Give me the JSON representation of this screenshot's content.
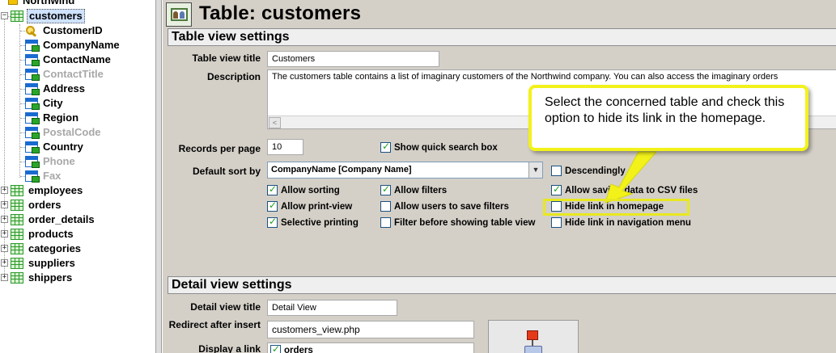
{
  "tree": {
    "root": "Northwind",
    "selected_table": "customers",
    "fields": [
      {
        "label": "CustomerID",
        "icon": "key-icon",
        "dim": false
      },
      {
        "label": "CompanyName",
        "icon": "field-icon",
        "dim": false
      },
      {
        "label": "ContactName",
        "icon": "field-icon",
        "dim": false
      },
      {
        "label": "ContactTitle",
        "icon": "field-icon",
        "dim": true
      },
      {
        "label": "Address",
        "icon": "field-icon",
        "dim": false
      },
      {
        "label": "City",
        "icon": "field-icon",
        "dim": false
      },
      {
        "label": "Region",
        "icon": "field-icon",
        "dim": false
      },
      {
        "label": "PostalCode",
        "icon": "field-icon",
        "dim": true
      },
      {
        "label": "Country",
        "icon": "field-icon",
        "dim": false
      },
      {
        "label": "Phone",
        "icon": "field-icon",
        "dim": true
      },
      {
        "label": "Fax",
        "icon": "field-icon",
        "dim": true
      }
    ],
    "tables": [
      "employees",
      "orders",
      "order_details",
      "products",
      "categories",
      "suppliers",
      "shippers"
    ],
    "expander_collapsed": "+",
    "expander_expanded": "−"
  },
  "header": {
    "title": "Table: customers",
    "icon": "users-table-icon"
  },
  "table_view": {
    "section_title": "Table view settings",
    "title_label": "Table view title",
    "title_value": "Customers",
    "description_label": "Description",
    "description_value": "The customers table contains a list of imaginary customers of the Northwind company. You can also access the imaginary orders",
    "scroll_left": "<",
    "records_label": "Records per page",
    "records_value": "10",
    "quick_search": {
      "label": "Show quick search box",
      "checked": true
    },
    "sort_label": "Default sort by",
    "sort_value": "CompanyName [Company Name]",
    "sort_dropdown": "▼",
    "descending": {
      "label": "Descendingly",
      "checked": false
    },
    "options": [
      {
        "label": "Allow sorting",
        "checked": true
      },
      {
        "label": "Allow filters",
        "checked": true
      },
      {
        "label": "Allow saving data to CSV files",
        "checked": true
      },
      {
        "label": "Allow print-view",
        "checked": true
      },
      {
        "label": "Allow users to save filters",
        "checked": false
      },
      {
        "label": "Hide link in homepage",
        "checked": false
      },
      {
        "label": "Selective printing",
        "checked": true
      },
      {
        "label": "Filter before showing table view",
        "checked": false
      },
      {
        "label": "Hide link in navigation menu",
        "checked": false
      }
    ]
  },
  "detail_view": {
    "section_title": "Detail view settings",
    "title_label": "Detail view title",
    "title_value": "Detail View",
    "redirect_label": "Redirect after insert",
    "redirect_value": "customers_view.php",
    "display_link_label": "Display a link",
    "display_link_option": {
      "label": "orders",
      "checked": true
    }
  },
  "callout": {
    "text": "Select the concerned table and check this option to hide its link in the homepage.",
    "border_color": "#f2f21a"
  },
  "colors": {
    "panel": "#d4d0c8",
    "check": "#21a121",
    "highlight": "#e8e820"
  }
}
